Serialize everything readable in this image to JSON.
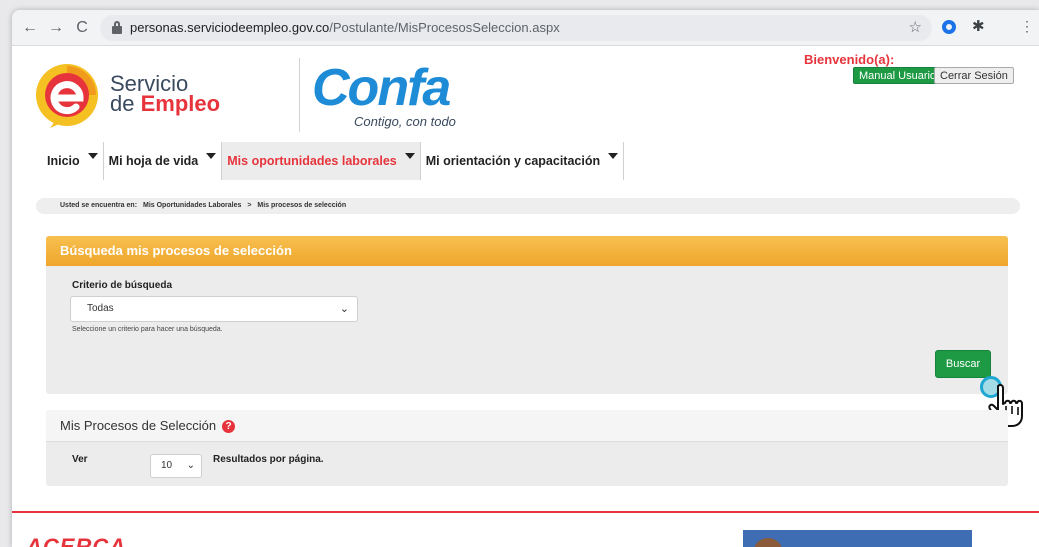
{
  "browser": {
    "url_domain": "personas.serviciodeempleo.gov.co",
    "url_path": "/Postulante/MisProcesosSeleccion.aspx",
    "back_icon": "←",
    "forward_icon": "→",
    "reload_icon": "C",
    "star_icon": "☆",
    "ext_icon": "✱",
    "menu_icon": "⋮"
  },
  "header": {
    "logo_line1": "Servicio",
    "logo_line2_prefix": "de",
    "logo_line2_highlight": "Empleo",
    "confa_logo": "Confa",
    "confa_tagline": "Contigo, con todo",
    "welcome": "Bienvenido(a):",
    "manual_button": "Manual Usuario",
    "logout_button": "Cerrar Sesión"
  },
  "menu": {
    "items": [
      {
        "label": "Inicio"
      },
      {
        "label": "Mi hoja de vida"
      },
      {
        "label": "Mis oportunidades laborales"
      },
      {
        "label": "Mi orientación y capacitación"
      }
    ]
  },
  "breadcrumb": {
    "prefix": "Usted se encuentra en:",
    "level1": "Mis Oportunidades Laborales",
    "separator": ">",
    "level2": "Mis procesos de selección"
  },
  "search": {
    "title": "Búsqueda mis procesos de selección",
    "criteria_label": "Criterio de búsqueda",
    "criteria_value": "Todas",
    "criteria_help": "Seleccione un criterio para hacer una búsqueda.",
    "search_button": "Buscar"
  },
  "results": {
    "title": "Mis Procesos de Selección",
    "help_icon": "?",
    "ver_label": "Ver",
    "page_size": "10",
    "per_page_label": "Resultados por página."
  },
  "footer": {
    "logo_text": "ACERCA"
  },
  "colors": {
    "accent_red": "#e7343c",
    "button_green": "#1e9a44",
    "header_orange": "#f0a62c",
    "confa_blue": "#1e8bd7"
  }
}
